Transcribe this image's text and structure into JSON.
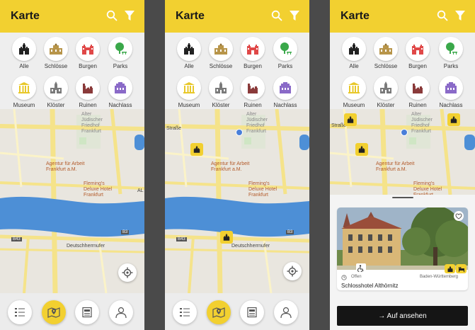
{
  "app": {
    "title": "Karte",
    "search_icon": "search-icon",
    "filter_icon": "filter-icon"
  },
  "categories": [
    {
      "label": "Alle",
      "icon": "castle-black-icon",
      "color": "#222222"
    },
    {
      "label": "Schlösse",
      "icon": "palace-icon",
      "color": "#b8954a"
    },
    {
      "label": "Burgen",
      "icon": "castle-red-icon",
      "color": "#e04848"
    },
    {
      "label": "Parks",
      "icon": "tree-icon",
      "color": "#3aa84a"
    },
    {
      "label": "Museum",
      "icon": "museum-icon",
      "color": "#e8c82a"
    },
    {
      "label": "Klöster",
      "icon": "church-icon",
      "color": "#7a7a7a"
    },
    {
      "label": "Ruinen",
      "icon": "ruin-icon",
      "color": "#8a3a3a"
    },
    {
      "label": "Nachlass",
      "icon": "archive-icon",
      "color": "#8a6ac8"
    }
  ],
  "map": {
    "labels": {
      "street_left": "Straße",
      "cemetery": "Alter\nJüdischer\nFriedhof\nFrankfurt",
      "agentur": "Agentur für Arbeit\nFrankfurt a.M.",
      "fleming": "Fleming's\nDeluxe Hotel\nFrankfurt",
      "al": "AL",
      "b3": "B3",
      "b43": "B43",
      "deutschherrnufer": "Deutschherrnufer"
    },
    "colors": {
      "river": "#4d8fd6",
      "road": "#f5e38a",
      "land": "#e9e6df",
      "park": "#cfe6c4"
    }
  },
  "bottom_nav": [
    {
      "name": "list-icon",
      "active": false
    },
    {
      "name": "map-icon",
      "active": true
    },
    {
      "name": "news-icon",
      "active": false
    },
    {
      "name": "profile-icon",
      "active": false
    }
  ],
  "detail": {
    "status": "Offen",
    "region": "Baden-Württemberg",
    "name": "Schlosshotel Althörnitz",
    "cta": "→ Auf ansehen",
    "favorite_icon": "heart-icon",
    "accessibility_icon": "wheelchair-icon"
  },
  "colors": {
    "accent": "#f2d030",
    "cta_bg": "#151515"
  }
}
